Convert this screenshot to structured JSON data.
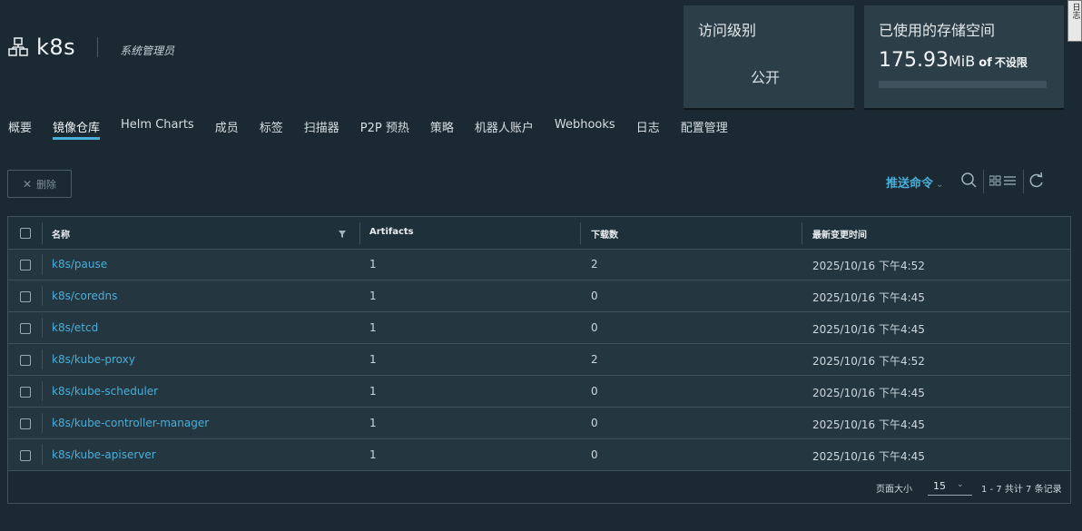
{
  "project": {
    "name": "k8s",
    "role": "系统管理员"
  },
  "cards": {
    "access": {
      "title": "访问级别",
      "value": "公开"
    },
    "storage": {
      "title": "已使用的存储空间",
      "amount": "175.93",
      "unit": "MiB",
      "of": "of",
      "limit": "不设限",
      "usage_fraction": 0.0
    }
  },
  "side_tab": {
    "text": "日志"
  },
  "tabs": [
    {
      "label": "概要"
    },
    {
      "label": "镜像仓库",
      "active": true
    },
    {
      "label": "Helm Charts"
    },
    {
      "label": "成员"
    },
    {
      "label": "标签"
    },
    {
      "label": "扫描器"
    },
    {
      "label": "P2P 预热"
    },
    {
      "label": "策略"
    },
    {
      "label": "机器人账户"
    },
    {
      "label": "Webhooks"
    },
    {
      "label": "日志"
    },
    {
      "label": "配置管理"
    }
  ],
  "toolbar": {
    "delete_label": "删除",
    "push_command_label": "推送命令"
  },
  "table": {
    "columns": [
      "名称",
      "Artifacts",
      "下载数",
      "最新变更时间"
    ],
    "rows": [
      {
        "name": "k8s/pause",
        "artifacts": "1",
        "pulls": "2",
        "updated": "2025/10/16 下午4:52"
      },
      {
        "name": "k8s/coredns",
        "artifacts": "1",
        "pulls": "0",
        "updated": "2025/10/16 下午4:45"
      },
      {
        "name": "k8s/etcd",
        "artifacts": "1",
        "pulls": "0",
        "updated": "2025/10/16 下午4:45"
      },
      {
        "name": "k8s/kube-proxy",
        "artifacts": "1",
        "pulls": "2",
        "updated": "2025/10/16 下午4:52"
      },
      {
        "name": "k8s/kube-scheduler",
        "artifacts": "1",
        "pulls": "0",
        "updated": "2025/10/16 下午4:45"
      },
      {
        "name": "k8s/kube-controller-manager",
        "artifacts": "1",
        "pulls": "0",
        "updated": "2025/10/16 下午4:45"
      },
      {
        "name": "k8s/kube-apiserver",
        "artifacts": "1",
        "pulls": "0",
        "updated": "2025/10/16 下午4:45"
      }
    ],
    "footer": {
      "page_size_label": "页面大小",
      "page_size_value": "15",
      "summary": "1 - 7 共计 7 条记录"
    }
  },
  "colors": {
    "background": "#1b2a32",
    "card": "#2c3e47",
    "accent": "#49aeda",
    "border": "#3f515a"
  }
}
